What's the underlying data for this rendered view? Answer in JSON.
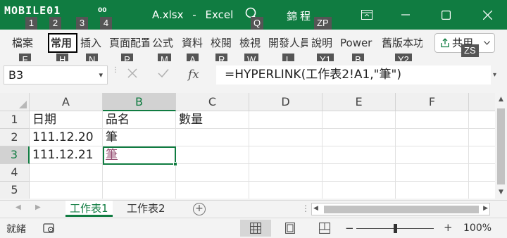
{
  "titlebar": {
    "logo_text": "MOBILE01",
    "logo_sub": "00",
    "filename": "A.xlsx",
    "separator": "-",
    "app_name": "Excel",
    "user": "錦程"
  },
  "ribbon": {
    "tabs": [
      {
        "label": "檔案",
        "keytip": "F"
      },
      {
        "label": "常用",
        "keytip": "H",
        "active": true
      },
      {
        "label": "插入",
        "keytip": "N"
      },
      {
        "label": "頁面配置",
        "keytip": "P"
      },
      {
        "label": "公式",
        "keytip": "M"
      },
      {
        "label": "資料",
        "keytip": "A"
      },
      {
        "label": "校閱",
        "keytip": "R"
      },
      {
        "label": "檢視",
        "keytip": "W"
      },
      {
        "label": "開發人員",
        "keytip": "L"
      },
      {
        "label": "說明",
        "keytip": "Y1"
      },
      {
        "label": "Power",
        "keytip": "B"
      },
      {
        "label": "舊版本功能",
        "keytip": "Y2"
      }
    ],
    "share_label": "共用",
    "share_keytip": "ZS"
  },
  "quick_access_keytips": [
    "1",
    "2",
    "3",
    "4"
  ],
  "search_keytip": "Q",
  "account_keytip": "ZP",
  "formula_bar": {
    "name_box": "B3",
    "fx_label": "fx",
    "formula": "=HYPERLINK(工作表2!A1,\"筆\")"
  },
  "grid": {
    "columns": [
      "A",
      "B",
      "C",
      "D",
      "E",
      "F"
    ],
    "rows": [
      {
        "num": "1",
        "cells": [
          "日期",
          "品名",
          "數量",
          "",
          "",
          ""
        ]
      },
      {
        "num": "2",
        "cells": [
          "111.12.20",
          "筆",
          "",
          "",
          "",
          ""
        ]
      },
      {
        "num": "3",
        "cells": [
          "111.12.21",
          "筆",
          "",
          "",
          "",
          ""
        ]
      },
      {
        "num": "4",
        "cells": [
          "",
          "",
          "",
          "",
          "",
          ""
        ]
      },
      {
        "num": "5",
        "cells": [
          "",
          "",
          "",
          "",
          "",
          ""
        ]
      }
    ],
    "selected_cell": "B3"
  },
  "sheets": {
    "tabs": [
      "工作表1",
      "工作表2"
    ],
    "active": "工作表1"
  },
  "status": {
    "text": "就緒",
    "zoom": "100%",
    "zoom_fraction": 0.5
  },
  "colors": {
    "brand": "#107c41",
    "hyperlink_visited": "#954f72"
  }
}
